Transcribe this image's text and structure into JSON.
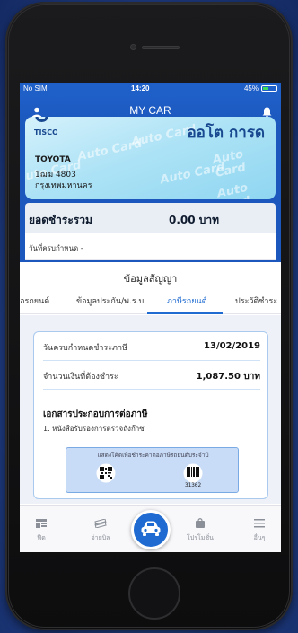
{
  "status_bar": {
    "carrier": "No SIM",
    "time": "14:20",
    "battery": "45%",
    "battery_level": 0.45
  },
  "navbar": {
    "title": "MY CAR"
  },
  "card": {
    "brand": "ออโต การด",
    "watermark": "Auto Card",
    "make": "TOYOTA",
    "plate": "1ฌฆ 4803",
    "province": "กรุงเทพมหานคร"
  },
  "total_due": {
    "label": "ยอดชำระรวม",
    "amount": "0.00 บาท",
    "due_date_label": "วันที่ครบกำหนด -"
  },
  "contract": {
    "title": "ข้อมูลสัญญา"
  },
  "tabs": [
    "ชื่อรถยนต์",
    "ข้อมูลประกัน/พ.ร.บ.",
    "ภาษีรถยนต์",
    "ประวัติชำระ"
  ],
  "active_tab": "ภาษีรถยนต์",
  "tax": {
    "due_label": "วันครบกำหนดชำระภาษี",
    "due_value": "13/02/2019",
    "amount_label": "จำนวนเงินที่ต้องชำระ",
    "amount_value": "1,087.50 บาท",
    "docs_title": "เอกสารประกอบการต่อภาษี",
    "docs_item": "1. หนังสือรับรองการตรวจถังก๊าซ",
    "scan_hint": "แสดงโค้ดเพื่อชำระค่าต่อภาษีรถยนต์ประจำปี",
    "barcode_number": "31362"
  },
  "tabbar": {
    "items": [
      {
        "label": "ฟีด",
        "icon": "feed-icon"
      },
      {
        "label": "จ่ายบิล",
        "icon": "bill-icon"
      },
      {
        "label": "",
        "icon": "car-icon"
      },
      {
        "label": "โปรโมชั่น",
        "icon": "promotion-bag-icon"
      },
      {
        "label": "อื่นๆ",
        "icon": "menu-icon"
      }
    ]
  },
  "colors": {
    "primary": "#1f5fc8",
    "accent": "#1f6bd1",
    "card": "#aee3f6"
  }
}
